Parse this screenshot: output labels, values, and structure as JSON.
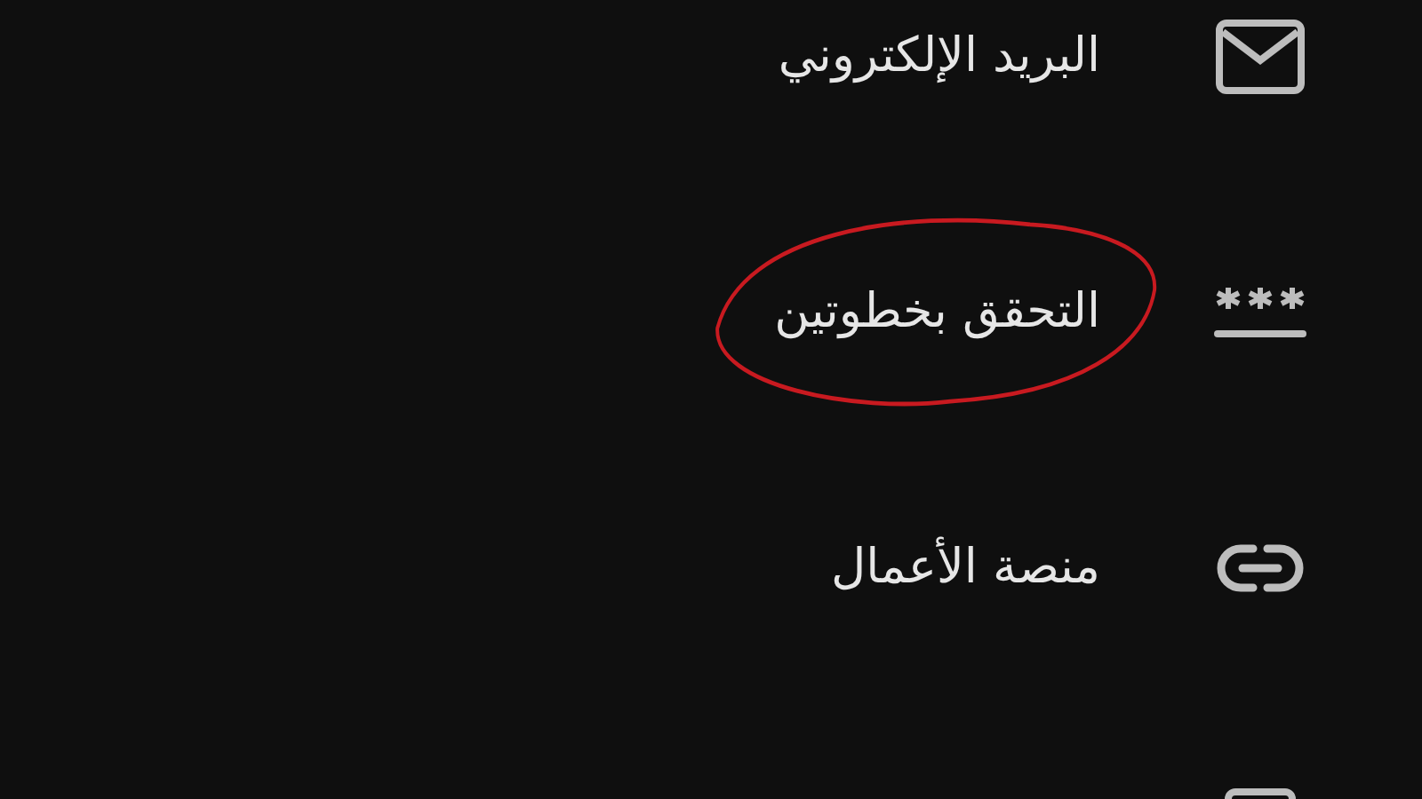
{
  "items": [
    {
      "kind": "email",
      "label": "البريد الإلكتروني",
      "highlighted": false
    },
    {
      "kind": "password",
      "label": "التحقق بخطوتين",
      "highlighted": true
    },
    {
      "kind": "link",
      "label": "منصة الأعمال",
      "highlighted": false
    },
    {
      "kind": "card",
      "highlighted": false
    }
  ]
}
